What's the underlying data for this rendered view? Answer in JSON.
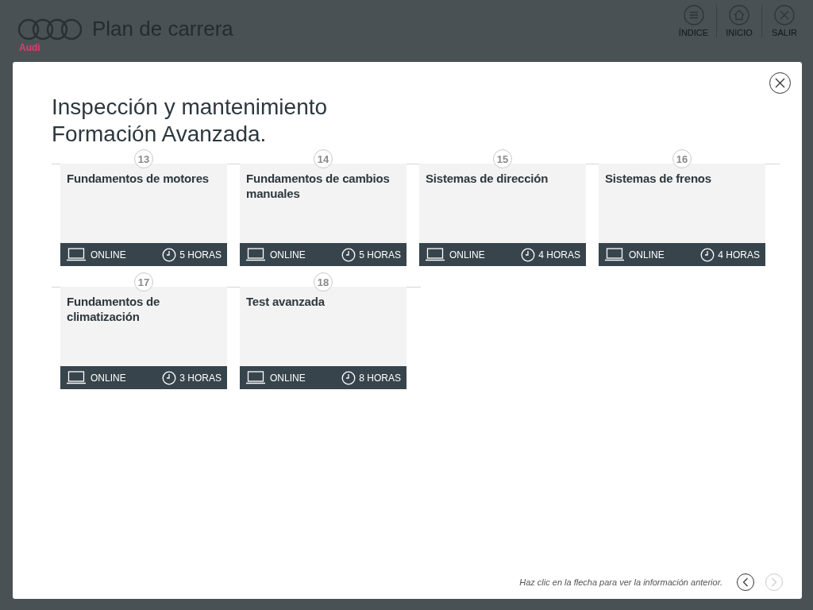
{
  "header": {
    "logo_text": "Audi",
    "title": "Plan de carrera",
    "nav": [
      {
        "kind": "index",
        "label": "ÍNDICE"
      },
      {
        "kind": "home",
        "label": "INICIO"
      },
      {
        "kind": "exit",
        "label": "SALIR"
      }
    ]
  },
  "modal": {
    "title_lines": [
      "Inspección y mantenimiento",
      "Formación Avanzada."
    ],
    "rows": [
      {
        "courses": [
          {
            "number": "13",
            "title": "Fundamentos de motores",
            "mode": "ONLINE",
            "duration": "5 HORAS"
          },
          {
            "number": "14",
            "title": "Fundamentos de cambios manuales",
            "mode": "ONLINE",
            "duration": "5 HORAS"
          },
          {
            "number": "15",
            "title": "Sistemas de dirección",
            "mode": "ONLINE",
            "duration": "4 HORAS"
          },
          {
            "number": "16",
            "title": "Sistemas de frenos",
            "mode": "ONLINE",
            "duration": "4 HORAS"
          }
        ]
      },
      {
        "courses": [
          {
            "number": "17",
            "title": "Fundamentos de climatización",
            "mode": "ONLINE",
            "duration": "3 HORAS"
          },
          {
            "number": "18",
            "title": "Test avanzada",
            "mode": "ONLINE",
            "duration": "8 HORAS"
          }
        ]
      }
    ],
    "hint": "Haz clic en la flecha para ver la información anterior.",
    "pager": [
      {
        "kind": "prev",
        "disabled": false
      },
      {
        "kind": "next",
        "disabled": true
      }
    ]
  }
}
